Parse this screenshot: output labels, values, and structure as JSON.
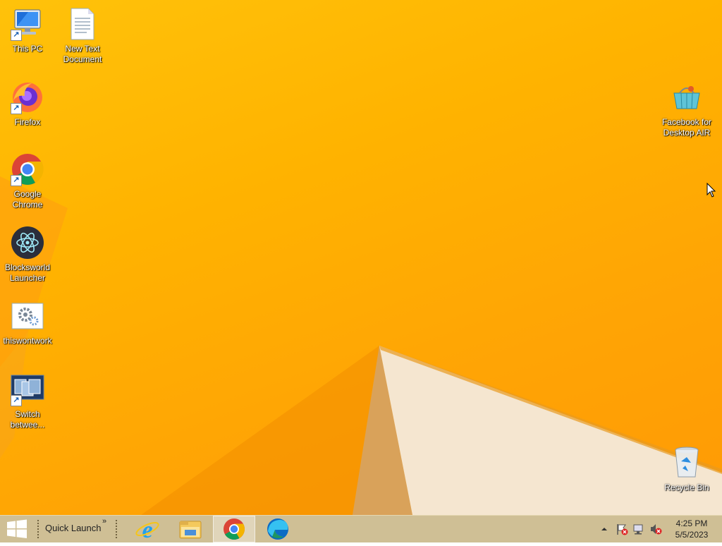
{
  "desktop": {
    "icons": [
      {
        "label": "This PC",
        "icon": "this-pc-icon"
      },
      {
        "label": "New Text\nDocument",
        "icon": "text-document-icon"
      },
      {
        "label": "Firefox",
        "icon": "firefox-icon"
      },
      {
        "label": "Google\nChrome",
        "icon": "chrome-icon"
      },
      {
        "label": "Blocksworld\nLauncher",
        "icon": "blocksworld-icon"
      },
      {
        "label": "thiswontwork",
        "icon": "settings-file-icon"
      },
      {
        "label": "Switch\nbetwee...",
        "icon": "switch-windows-icon"
      },
      {
        "label": "Facebook for\nDesktop AIR",
        "icon": "facebook-air-icon"
      },
      {
        "label": "Recycle Bin",
        "icon": "recycle-bin-icon"
      }
    ]
  },
  "taskbar": {
    "start_icon": "windows-logo-icon",
    "quick_launch_label": "Quick Launch",
    "quick_launch_chevron": "»",
    "apps": [
      {
        "name": "Internet Explorer",
        "icon": "ie-icon",
        "active": false
      },
      {
        "name": "File Explorer",
        "icon": "file-explorer-icon",
        "active": false
      },
      {
        "name": "Google Chrome",
        "icon": "chrome-icon",
        "active": true
      },
      {
        "name": "Microsoft Edge",
        "icon": "edge-icon",
        "active": false
      }
    ],
    "tray": {
      "time": "4:25 PM",
      "date": "5/5/2023",
      "icons": [
        "show-hidden-icons-icon",
        "action-center-flag-icon",
        "network-icon",
        "volume-muted-icon"
      ]
    }
  },
  "colors": {
    "wallpaper": "#ffb300",
    "taskbar": "#cfbf95"
  }
}
